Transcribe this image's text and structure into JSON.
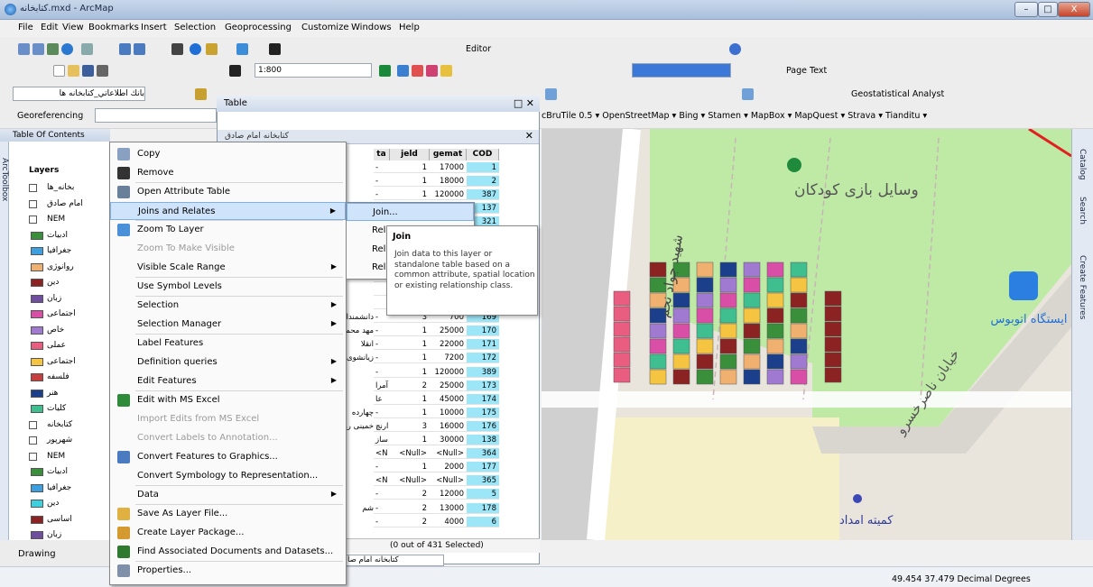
{
  "window": {
    "title": "کتابخانه.mxd - ArcMap",
    "buttons": [
      "–",
      "□",
      "X"
    ]
  },
  "menubar": [
    "File",
    "Edit",
    "View",
    "Bookmarks",
    "Insert",
    "Selection",
    "Geoprocessing",
    "Customize",
    "Windows",
    "Help"
  ],
  "toolbars": {
    "editor_label": "Editor",
    "scale": "1:800",
    "page_text": "Page Text",
    "layer_combo": "بانك اطلاعاتي_كتابخانه ها",
    "georeferencing": "Georeferencing",
    "geostatistical": "Geostatistical Analyst",
    "basemaps": "cBruTile 0.5 ▾  OpenStreetMap ▾  Bing ▾  Stamen ▾  MapBox ▾  MapQuest ▾  Strava ▾  Tianditu ▾"
  },
  "toc": {
    "header": "Table Of Contents",
    "side_tab": "ArcToolbox",
    "layers_label": "Layers",
    "items": [
      {
        "label": "بخانه_ها"
      },
      {
        "label": "امام صادق"
      },
      {
        "label": "NEM"
      },
      {
        "label": "ادبیات",
        "color": "#3a8f3a"
      },
      {
        "label": "جغرافیا",
        "color": "#3b9fe0"
      },
      {
        "label": "روانوژی",
        "color": "#f0b070"
      },
      {
        "label": "دین",
        "color": "#8b2323"
      },
      {
        "label": "زبان",
        "color": "#6f4ea0"
      },
      {
        "label": "اجتماعی",
        "color": "#d94fa8"
      },
      {
        "label": "خاص",
        "color": "#a07ad0"
      },
      {
        "label": "عملی",
        "color": "#e85d80"
      },
      {
        "label": "اجتماعی",
        "color": "#f5c542"
      },
      {
        "label": "فلسفه",
        "color": "#c83d3d"
      },
      {
        "label": "هنر",
        "color": "#1c3f8c"
      },
      {
        "label": "کلیات",
        "color": "#3fbf8f"
      },
      {
        "label": "کتابخانه"
      },
      {
        "label": "شهرپور"
      },
      {
        "label": "NEM"
      },
      {
        "label": "ادبیات",
        "color": "#3a8f3a"
      },
      {
        "label": "جغرافیا",
        "color": "#3b9fe0"
      },
      {
        "label": "دین",
        "color": "#3fd0e0"
      },
      {
        "label": "اساسی",
        "color": "#8b2323"
      },
      {
        "label": "زبان",
        "color": "#6f4ea0"
      },
      {
        "label": "اجتماعی",
        "color": "#d94fa8"
      }
    ]
  },
  "table": {
    "title": "Table",
    "tab_title": "کتابخانه امام صادق",
    "columns": [
      "ta",
      "jeld",
      "gemat",
      "COD"
    ],
    "rows": [
      [
        "-",
        "1",
        "17000",
        "1"
      ],
      [
        "-",
        "1",
        "18000",
        "2"
      ],
      [
        "-",
        "1",
        "120000",
        "387"
      ],
      [
        "",
        "",
        "",
        "137"
      ],
      [
        "",
        "",
        "",
        "321"
      ],
      [
        "",
        "",
        "",
        ""
      ],
      [
        "",
        "",
        "",
        ""
      ],
      [
        "",
        "",
        "",
        ""
      ],
      [
        "",
        "",
        "",
        ""
      ],
      [
        "",
        "",
        "",
        ""
      ],
      [
        "",
        "",
        "",
        ""
      ],
      [
        "-",
        "3",
        "700",
        "169"
      ],
      [
        "-",
        "1",
        "25000",
        "170"
      ],
      [
        "-",
        "1",
        "22000",
        "171"
      ],
      [
        "-",
        "1",
        "7200",
        "172"
      ],
      [
        "-",
        "1",
        "120000",
        "389"
      ],
      [
        "آمرا",
        "2",
        "25000",
        "173"
      ],
      [
        "عا",
        "1",
        "45000",
        "174"
      ],
      [
        "-",
        "1",
        "10000",
        "175"
      ],
      [
        "ارنچ",
        "3",
        "16000",
        "176"
      ],
      [
        "ساز",
        "1",
        "30000",
        "138"
      ],
      [
        "<N",
        "<Null>",
        "<Null>",
        "364"
      ],
      [
        "-",
        "1",
        "2000",
        "177"
      ],
      [
        "<N",
        "<Null>",
        "<Null>",
        "365"
      ],
      [
        "-",
        "2",
        "12000",
        "5"
      ],
      [
        "-",
        "2",
        "13000",
        "178"
      ],
      [
        "-",
        "2",
        "4000",
        "6"
      ]
    ],
    "left_col": [
      "",
      "",
      "",
      "",
      "",
      "",
      "",
      "",
      "",
      "",
      "",
      "دانشمندان",
      "مهد محمدین ح",
      "انقلا",
      "زیانشوی",
      "",
      "",
      "",
      "چهارده",
      "خمینی رو",
      "",
      "",
      "",
      "",
      "",
      "شم",
      ""
    ],
    "footer": "(0 out of 431 Selected)",
    "bottom_tab": "کتابخانه امام صا"
  },
  "context_menu": {
    "items": [
      {
        "label": "Copy",
        "icon": "copy-icon"
      },
      {
        "label": "Remove",
        "icon": "remove-icon"
      },
      {
        "label": "Open Attribute Table",
        "icon": "table-icon"
      },
      {
        "label": "Joins and Relates",
        "submenu": true,
        "hover": true
      },
      {
        "label": "Zoom To Layer",
        "icon": "zoom-layer-icon"
      },
      {
        "label": "Zoom To Make Visible",
        "disabled": true
      },
      {
        "label": "Visible Scale Range",
        "submenu": true
      },
      {
        "label": "Use Symbol Levels"
      },
      {
        "label": "Selection",
        "submenu": true
      },
      {
        "label": "Selection Manager",
        "submenu": true
      },
      {
        "label": "Label Features"
      },
      {
        "label": "Definition queries",
        "submenu": true
      },
      {
        "label": "Edit Features",
        "submenu": true
      },
      {
        "label": "Edit with MS Excel",
        "icon": "excel-icon"
      },
      {
        "label": "Import Edits from MS Excel",
        "disabled": true
      },
      {
        "label": "Convert Labels to Annotation...",
        "disabled": true
      },
      {
        "label": "Convert Features to Graphics...",
        "icon": "convert-icon"
      },
      {
        "label": "Convert Symbology to Representation..."
      },
      {
        "label": "Data",
        "submenu": true
      },
      {
        "label": "Save As Layer File...",
        "icon": "save-layer-icon"
      },
      {
        "label": "Create Layer Package...",
        "icon": "package-icon"
      },
      {
        "label": "Find Associated Documents and Datasets...",
        "icon": "find-docs-icon"
      },
      {
        "label": "Properties...",
        "icon": "properties-icon"
      }
    ]
  },
  "submenu": {
    "items": [
      "Join...",
      "Rel",
      "Rel",
      "Rel"
    ]
  },
  "tooltip": {
    "title": "Join",
    "body": "Join data to this layer or standalone table based on a common attribute, spatial location or existing relationship class."
  },
  "map": {
    "labels": {
      "park": "وسایل بازی کودکان",
      "street1": "شهید جواد نجم",
      "street2": "خیابان ناصرخسرو",
      "bus": "ایستگاه اتوبوس",
      "relief": "کمیته امداد"
    }
  },
  "right_tabs": [
    "Catalog",
    "Search",
    "Create Features"
  ],
  "drawing": "Drawing",
  "status": {
    "coords": "49.454  37.479 Decimal Degrees"
  }
}
